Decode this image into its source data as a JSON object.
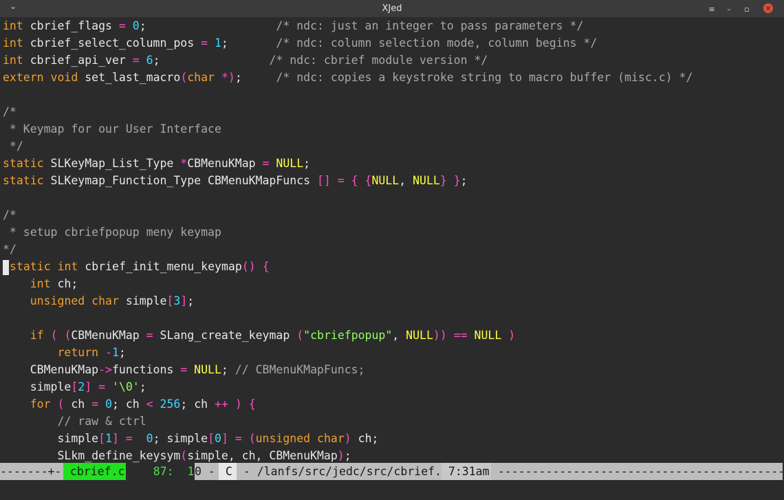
{
  "window": {
    "title": "XJed",
    "menu_icon": "chevron-down-icon",
    "buttons": [
      "menu-lines-icon",
      "minimize-icon",
      "maximize-icon",
      "close-icon"
    ],
    "button_glyphs": [
      "≡",
      "–",
      "▫",
      "✕"
    ]
  },
  "editor": {
    "cursor_line": 14,
    "lines": [
      [
        [
          "int",
          "kw"
        ],
        [
          " cbrief_flags ",
          "id"
        ],
        [
          "=",
          "op"
        ],
        [
          " ",
          "id"
        ],
        [
          "0",
          "num"
        ],
        [
          ";",
          "id"
        ],
        [
          "                   /* ndc: just an integer to pass parameters */",
          "com"
        ]
      ],
      [
        [
          "int",
          "kw"
        ],
        [
          " cbrief_select_column_pos ",
          "id"
        ],
        [
          "=",
          "op"
        ],
        [
          " ",
          "id"
        ],
        [
          "1",
          "num"
        ],
        [
          ";",
          "id"
        ],
        [
          "       /* ndc: column selection mode, column begins */",
          "com"
        ]
      ],
      [
        [
          "int",
          "kw"
        ],
        [
          " cbrief_api_ver ",
          "id"
        ],
        [
          "=",
          "op"
        ],
        [
          " ",
          "id"
        ],
        [
          "6",
          "num"
        ],
        [
          ";",
          "id"
        ],
        [
          "                /* ndc: cbrief module version */",
          "com"
        ]
      ],
      [
        [
          "extern",
          "kw"
        ],
        [
          " ",
          "id"
        ],
        [
          "void",
          "kw"
        ],
        [
          " set_last_macro",
          "id"
        ],
        [
          "(",
          "br"
        ],
        [
          "char",
          "kw"
        ],
        [
          " ",
          "id"
        ],
        [
          "*",
          "op"
        ],
        [
          ")",
          "br"
        ],
        [
          ";",
          "id"
        ],
        [
          "     /* ndc: copies a keystroke string to macro buffer (misc.c) */",
          "com"
        ]
      ],
      [
        [
          "",
          "id"
        ]
      ],
      [
        [
          "/*",
          "com"
        ]
      ],
      [
        [
          " * Keymap for our User Interface",
          "com"
        ]
      ],
      [
        [
          " */",
          "com"
        ]
      ],
      [
        [
          "static",
          "kw"
        ],
        [
          " SLKeyMap_List_Type ",
          "id"
        ],
        [
          "*",
          "op"
        ],
        [
          "CBMenuKMap ",
          "id"
        ],
        [
          "=",
          "op"
        ],
        [
          " ",
          "id"
        ],
        [
          "NULL",
          "lit"
        ],
        [
          ";",
          "id"
        ]
      ],
      [
        [
          "static",
          "kw"
        ],
        [
          " SLKeymap_Function_Type CBMenuKMapFuncs ",
          "id"
        ],
        [
          "[]",
          "br"
        ],
        [
          " ",
          "id"
        ],
        [
          "=",
          "op"
        ],
        [
          " ",
          "id"
        ],
        [
          "{",
          "br"
        ],
        [
          " ",
          "id"
        ],
        [
          "{",
          "br"
        ],
        [
          "NULL",
          "lit"
        ],
        [
          ", ",
          "id"
        ],
        [
          "NULL",
          "lit"
        ],
        [
          "}",
          "br"
        ],
        [
          " ",
          "id"
        ],
        [
          "}",
          "br"
        ],
        [
          ";",
          "id"
        ]
      ],
      [
        [
          "",
          "id"
        ]
      ],
      [
        [
          "/*",
          "com"
        ]
      ],
      [
        [
          " * setup cbriefpopup meny keymap",
          "com"
        ]
      ],
      [
        [
          "*/",
          "com"
        ]
      ],
      [
        [
          "static",
          "kw"
        ],
        [
          " ",
          "id"
        ],
        [
          "int",
          "kw"
        ],
        [
          " cbrief_init_menu_keymap",
          "id"
        ],
        [
          "()",
          "br"
        ],
        [
          " ",
          "id"
        ],
        [
          "{",
          "br"
        ]
      ],
      [
        [
          "    ",
          "id"
        ],
        [
          "int",
          "kw"
        ],
        [
          " ch;",
          "id"
        ]
      ],
      [
        [
          "    ",
          "id"
        ],
        [
          "unsigned",
          "kw"
        ],
        [
          " ",
          "id"
        ],
        [
          "char",
          "kw"
        ],
        [
          " simple",
          "id"
        ],
        [
          "[",
          "br"
        ],
        [
          "3",
          "num"
        ],
        [
          "]",
          "br"
        ],
        [
          ";",
          "id"
        ]
      ],
      [
        [
          "",
          "id"
        ]
      ],
      [
        [
          "    ",
          "id"
        ],
        [
          "if",
          "kw"
        ],
        [
          " ",
          "id"
        ],
        [
          "(",
          "br"
        ],
        [
          " ",
          "id"
        ],
        [
          "(",
          "br"
        ],
        [
          "CBMenuKMap ",
          "id"
        ],
        [
          "=",
          "op"
        ],
        [
          " SLang_create_keymap ",
          "id"
        ],
        [
          "(",
          "br"
        ],
        [
          "\"cbriefpopup\"",
          "str"
        ],
        [
          ", ",
          "id"
        ],
        [
          "NULL",
          "lit"
        ],
        [
          "))",
          "br"
        ],
        [
          " ",
          "id"
        ],
        [
          "==",
          "op"
        ],
        [
          " ",
          "id"
        ],
        [
          "NULL",
          "lit"
        ],
        [
          " ",
          "id"
        ],
        [
          ")",
          "br"
        ]
      ],
      [
        [
          "        ",
          "id"
        ],
        [
          "return",
          "kw"
        ],
        [
          " ",
          "id"
        ],
        [
          "-",
          "op"
        ],
        [
          "1",
          "num"
        ],
        [
          ";",
          "id"
        ]
      ],
      [
        [
          "    CBMenuKMap",
          "id"
        ],
        [
          "->",
          "op"
        ],
        [
          "functions ",
          "id"
        ],
        [
          "=",
          "op"
        ],
        [
          " ",
          "id"
        ],
        [
          "NULL",
          "lit"
        ],
        [
          "; ",
          "id"
        ],
        [
          "// CBMenuKMapFuncs;",
          "com"
        ]
      ],
      [
        [
          "    simple",
          "id"
        ],
        [
          "[",
          "br"
        ],
        [
          "2",
          "num"
        ],
        [
          "]",
          "br"
        ],
        [
          " ",
          "id"
        ],
        [
          "=",
          "op"
        ],
        [
          " ",
          "id"
        ],
        [
          "'\\0'",
          "str"
        ],
        [
          ";",
          "id"
        ]
      ],
      [
        [
          "    ",
          "id"
        ],
        [
          "for",
          "kw"
        ],
        [
          " ",
          "id"
        ],
        [
          "(",
          "br"
        ],
        [
          " ch ",
          "id"
        ],
        [
          "=",
          "op"
        ],
        [
          " ",
          "id"
        ],
        [
          "0",
          "num"
        ],
        [
          "; ch ",
          "id"
        ],
        [
          "<",
          "op"
        ],
        [
          " ",
          "id"
        ],
        [
          "256",
          "num"
        ],
        [
          "; ch ",
          "id"
        ],
        [
          "++",
          "op"
        ],
        [
          " ",
          "id"
        ],
        [
          ")",
          "br"
        ],
        [
          " ",
          "id"
        ],
        [
          "{",
          "br"
        ]
      ],
      [
        [
          "        ",
          "id"
        ],
        [
          "// raw & ctrl",
          "com"
        ]
      ],
      [
        [
          "        simple",
          "id"
        ],
        [
          "[",
          "br"
        ],
        [
          "1",
          "num"
        ],
        [
          "]",
          "br"
        ],
        [
          " ",
          "id"
        ],
        [
          "=",
          "op"
        ],
        [
          "  ",
          "id"
        ],
        [
          "0",
          "num"
        ],
        [
          "; simple",
          "id"
        ],
        [
          "[",
          "br"
        ],
        [
          "0",
          "num"
        ],
        [
          "]",
          "br"
        ],
        [
          " ",
          "id"
        ],
        [
          "=",
          "op"
        ],
        [
          " ",
          "id"
        ],
        [
          "(",
          "br"
        ],
        [
          "unsigned",
          "kw"
        ],
        [
          " ",
          "id"
        ],
        [
          "char",
          "kw"
        ],
        [
          ")",
          "br"
        ],
        [
          " ch;",
          "id"
        ]
      ],
      [
        [
          "        SLkm_define_keysym",
          "id"
        ],
        [
          "(",
          "br"
        ],
        [
          "simple, ch, CBMenuKMap",
          "id"
        ],
        [
          ")",
          "br"
        ],
        [
          ";",
          "id"
        ]
      ]
    ]
  },
  "status": {
    "left_dashes": "-------+- ",
    "filename": " cbrief.c ",
    "line_info": "    87:  1  ",
    "col_info": "0 - ",
    "mode": " C ",
    "path": " - /lanfs/src/jedc/src/cbrief.c - ",
    "time": " 7:31am ",
    "right_dashes": " ------------------------------------------------------------"
  }
}
